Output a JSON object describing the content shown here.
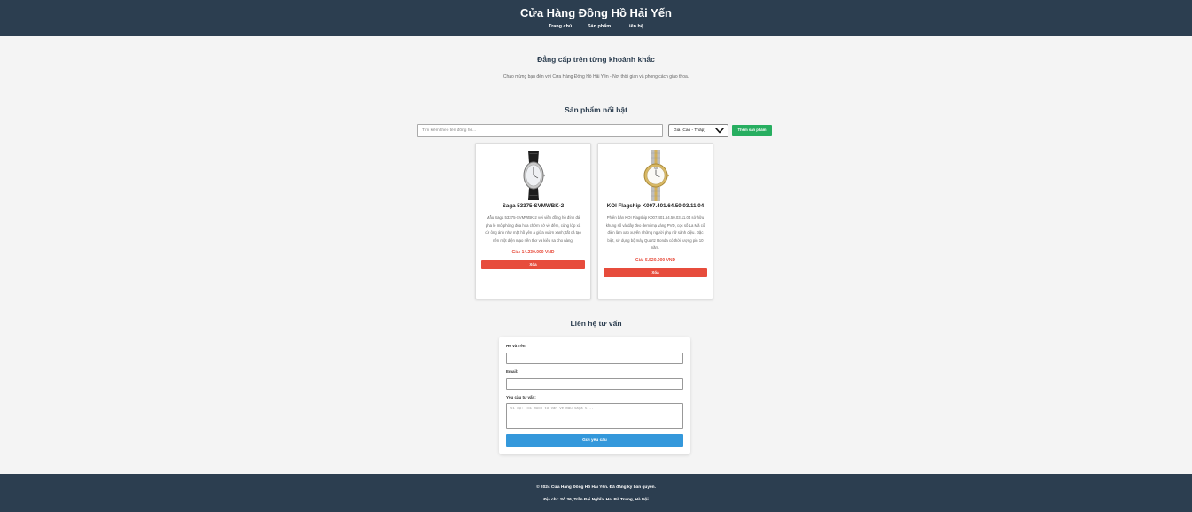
{
  "header": {
    "title": "Cửa Hàng Đồng Hồ Hải Yến",
    "nav": [
      "Trang chủ",
      "Sản phẩm",
      "Liên hệ"
    ]
  },
  "hero": {
    "title": "Đẳng cấp trên từng khoảnh khắc",
    "subtitle": "Chào mừng bạn đến với Cửa Hàng Đồng Hồ Hải Yến - Nơi thời gian và phong cách giao thoa."
  },
  "products": {
    "title": "Sản phẩm nổi bật",
    "search_placeholder": "Tìm kiếm theo tên đồng hồ...",
    "sort_value": "Giá (Cao - Thấp)",
    "add_label": "Thêm sản phẩm",
    "items": [
      {
        "name": "Saga 53375-SVMWBK-2",
        "desc": "Mẫu Saga 53375-SVMWBK-2 với viền đồng hồ đính đá pha lê mô phỏng đóa hoa chớm nở về đêm, cùng lớp xà cừ ông ánh như mặt hồ yên ả giữa vườn xanh; tất cả tạo nên một diện mạo nền thơ và kiêu sa cho nàng.",
        "price": "Giá: 14.230.000 VNĐ",
        "delete_label": "Xóa"
      },
      {
        "name": "KOI Flagship K007.401.64.50.03.11.04",
        "desc": "Phiên bản KOI Flagship K007.401.64.50.03.11.04 sở hữu khung số và dây đeo demi mạ vàng PVD, cọc số La Mã cổ điển làm xao xuyến những người phụ nữ sành điệu. Đặc biệt, sử dụng bộ máy Quartz Ronda có thời lượng pin 10 năm.",
        "price": "Giá: 5.520.000 VNĐ",
        "delete_label": "Xóa"
      }
    ]
  },
  "contact": {
    "title": "Liên hệ tư vấn",
    "name_label": "Họ và Tên:",
    "email_label": "Email:",
    "request_label": "Yêu cầu tư vấn:",
    "request_placeholder": "Ví dụ: Tôi muốn tư vấn về mẫu Saga 5...",
    "submit_label": "Gửi yêu cầu"
  },
  "footer": {
    "copyright": "© 2024 Cửa Hàng Đồng Hồ Hải Yến. Đã đăng ký bản quyền.",
    "address": "Địa chỉ: Số 36, Trần Đại Nghĩa, Hai Bà Trưng, Hà Nội"
  },
  "colors": {
    "header_bg": "#2c3e50",
    "add_button": "#27ae60",
    "delete_button": "#e74c3c",
    "price": "#e74c3c",
    "submit_button": "#3498db"
  }
}
